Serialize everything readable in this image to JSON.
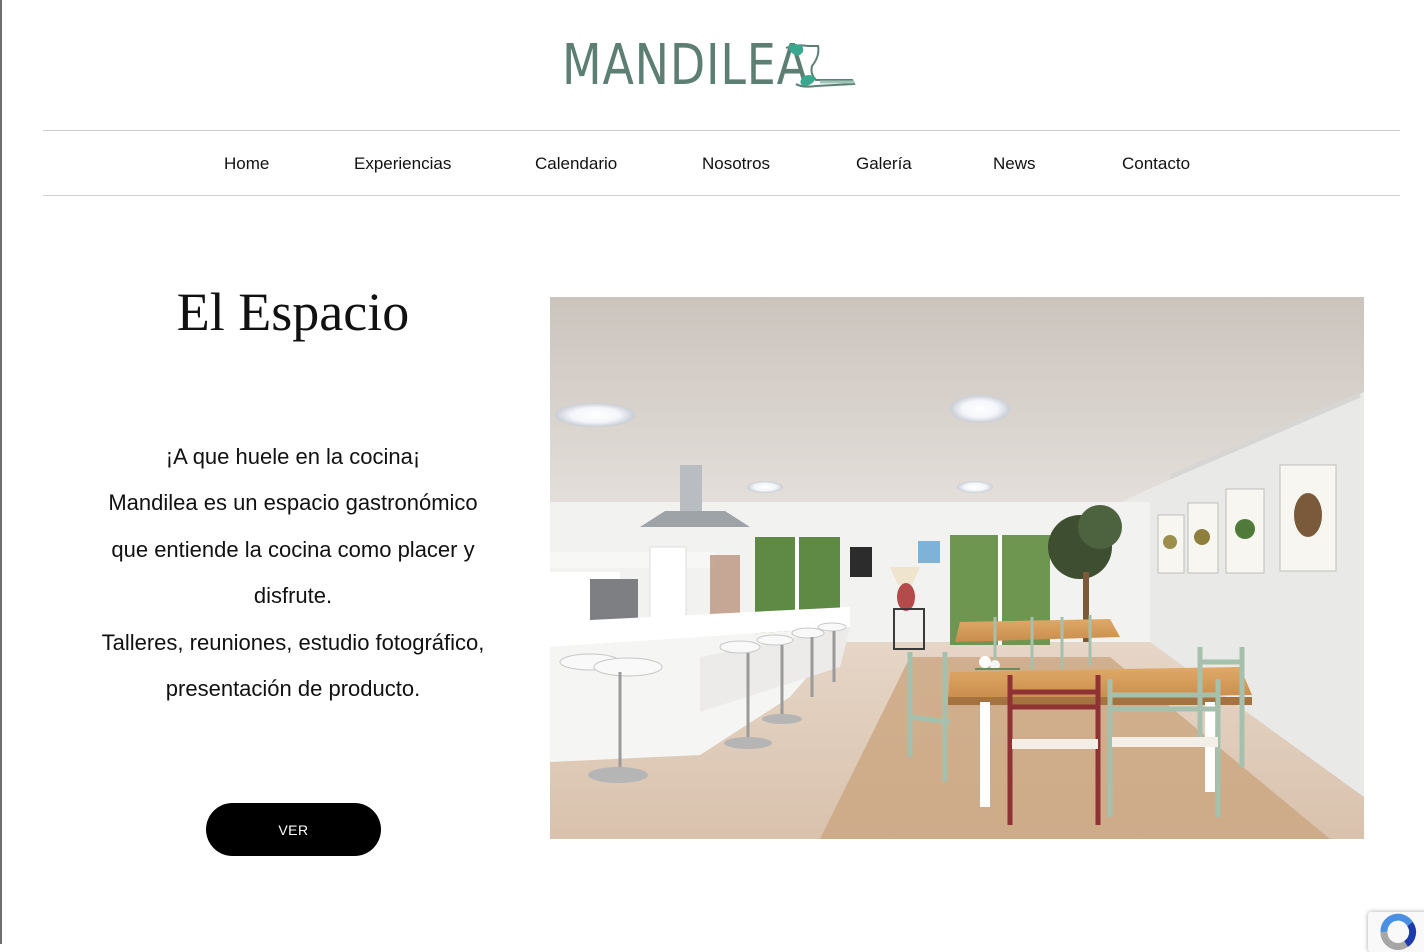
{
  "brand": {
    "logo_text": "MANDILEA",
    "logo_color": "#5d7f73",
    "logo_accent": "#3aa88f"
  },
  "nav": {
    "items": [
      {
        "label": "Home"
      },
      {
        "label": "Experiencias"
      },
      {
        "label": "Calendario"
      },
      {
        "label": "Nosotros"
      },
      {
        "label": "Galería"
      },
      {
        "label": "News"
      },
      {
        "label": "Contacto"
      }
    ]
  },
  "main": {
    "title": "El Espacio",
    "description_lines": [
      "¡A que huele en la cocina¡",
      "Mandilea es un espacio gastronómico",
      "que entiende la cocina como placer y",
      "disfrute.",
      "Talleres, reuniones, estudio fotográfico,",
      "presentación de producto."
    ],
    "button_label": "VER",
    "photo_icon": "kitchen-dining-photo"
  },
  "recaptcha": {
    "icon": "recaptcha-icon"
  }
}
